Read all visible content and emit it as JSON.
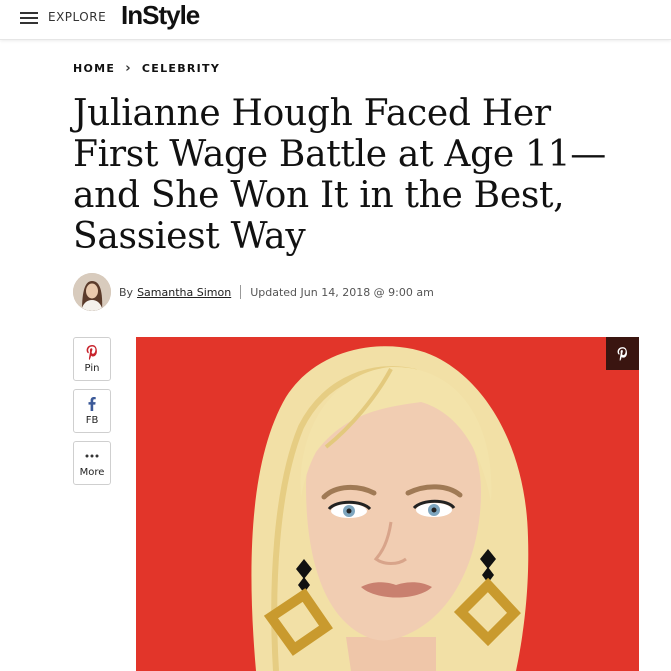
{
  "header": {
    "explore_label": "EXPLORE",
    "logo_text": "InStyle"
  },
  "breadcrumb": {
    "home": "HOME",
    "category": "CELEBRITY"
  },
  "article": {
    "title_lines": [
      "Julianne Hough Faced Her",
      "First Wage Battle at Age 11—",
      "and She Won It in the Best,",
      "Sassiest Way"
    ],
    "by_prefix": "By",
    "author": "Samantha Simon",
    "updated": "Updated Jun 14, 2018 @ 9:00 am"
  },
  "share": {
    "pin_label": "Pin",
    "fb_label": "FB",
    "more_label": "More"
  },
  "colors": {
    "hero_bg": "#e2352a",
    "pinterest_red": "#c8232c",
    "facebook_blue": "#3b5998"
  },
  "icons": {
    "menu": "hamburger-icon",
    "chevron": "chevron-right-icon",
    "pin": "pinterest-icon",
    "fb": "facebook-icon",
    "more": "more-dots-icon"
  }
}
